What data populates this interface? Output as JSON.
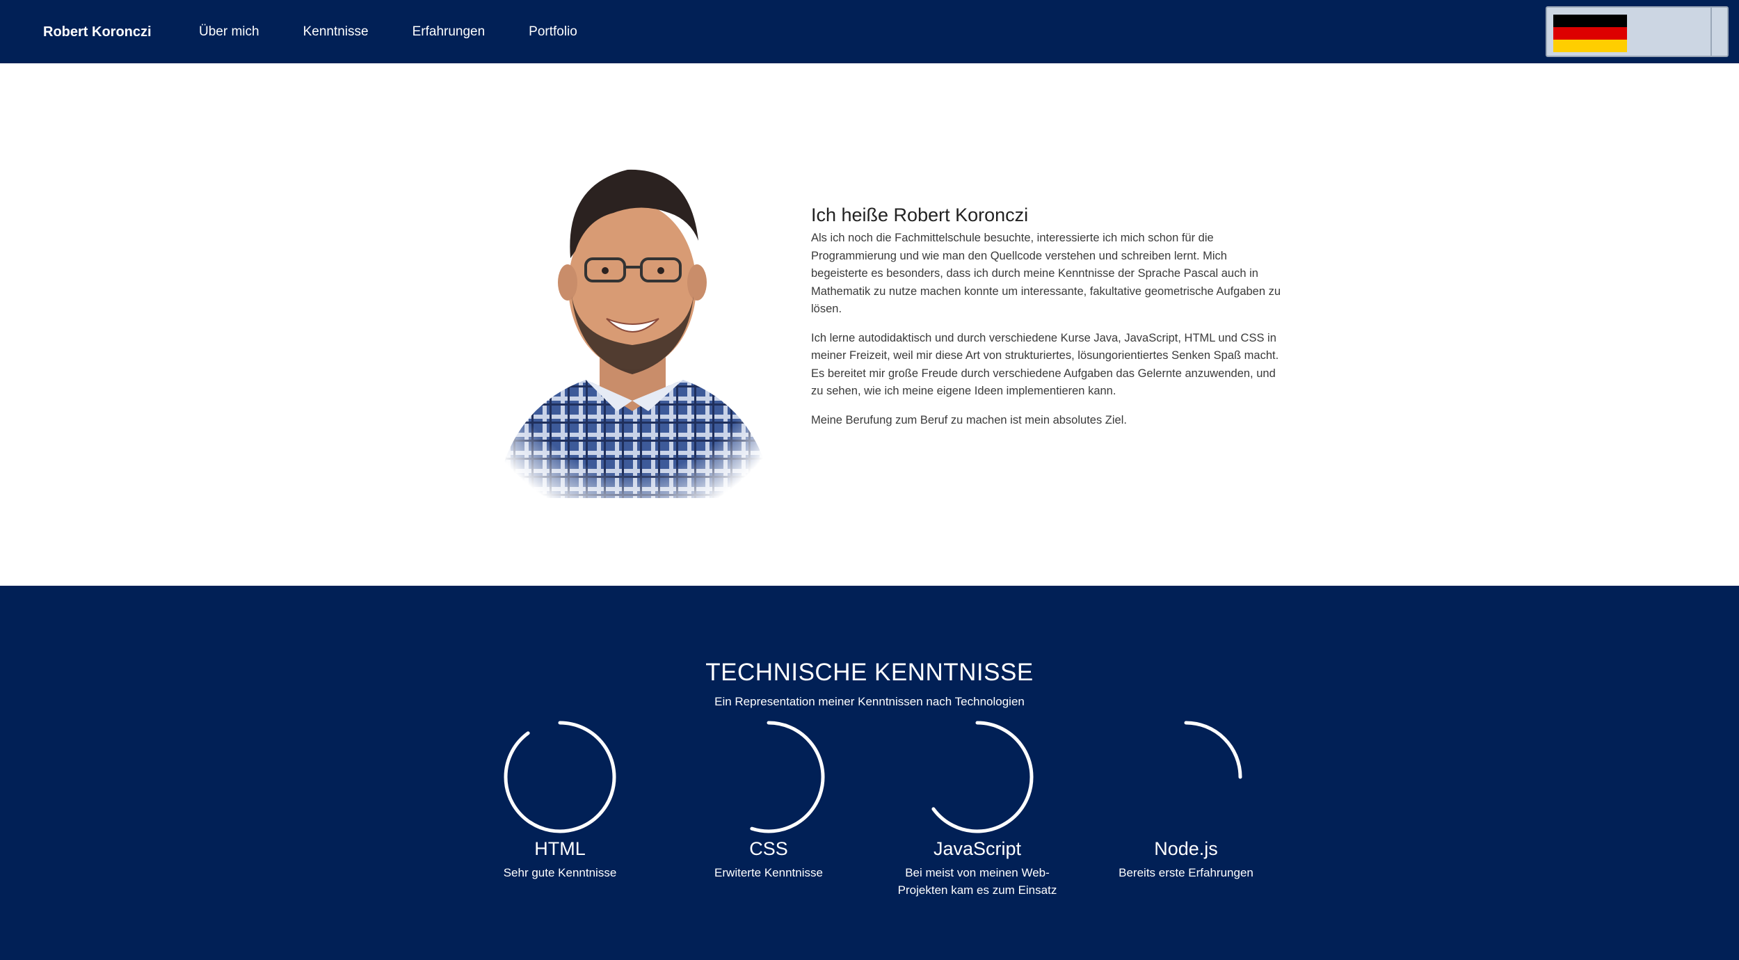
{
  "navbar": {
    "brand": "Robert Koronczi",
    "links": [
      "Über mich",
      "Kenntnisse",
      "Erfahrungen",
      "Portfolio"
    ],
    "language": {
      "flag_icon": "german-flag-icon",
      "flag_colors": [
        "#000000",
        "#DD0000",
        "#FFCE00"
      ]
    }
  },
  "about": {
    "title": "Ich heiße Robert Koronczi",
    "paragraphs": [
      "Als ich noch die Fachmittelschule besuchte, interessierte ich mich schon für die Programmierung und wie man den Quellcode verstehen und schreiben lernt. Mich begeisterte es besonders, dass ich durch meine Kenntnisse der Sprache Pascal auch in Mathematik zu nutze machen konnte um interessante, fakultative geometrische Aufgaben zu lösen.",
      "Ich lerne autodidaktisch und durch verschiedene Kurse Java, JavaScript, HTML und CSS in meiner Freizeit, weil mir diese Art von strukturiertes, lösungorientiertes Senken Spaß macht. Es bereitet mir große Freude durch verschiedene Aufgaben das Gelernte anzuwenden, und zu sehen, wie ich meine eigene Ideen implementieren kann.",
      "Meine Berufung zum Beruf zu machen ist mein absolutes Ziel."
    ]
  },
  "skills": {
    "title": "TECHNISCHE KENNTNISSE",
    "subtitle": "Ein Representation meiner Kenntnissen nach Technologien",
    "items": [
      {
        "name": "HTML",
        "description": "Sehr gute Kenntnisse",
        "level": 0.9
      },
      {
        "name": "CSS",
        "description": "Erwiterte Kenntnisse",
        "level": 0.55
      },
      {
        "name": "JavaScript",
        "description": "Bei meist von meinen Web-Projekten kam es zum Einsatz",
        "level": 0.65
      },
      {
        "name": "Node.js",
        "description": "Bereits erste Erfahrungen",
        "level": 0.25
      }
    ]
  },
  "colors": {
    "brand_navy": "#012056",
    "text_dark": "#222222",
    "white": "#FFFFFF"
  }
}
